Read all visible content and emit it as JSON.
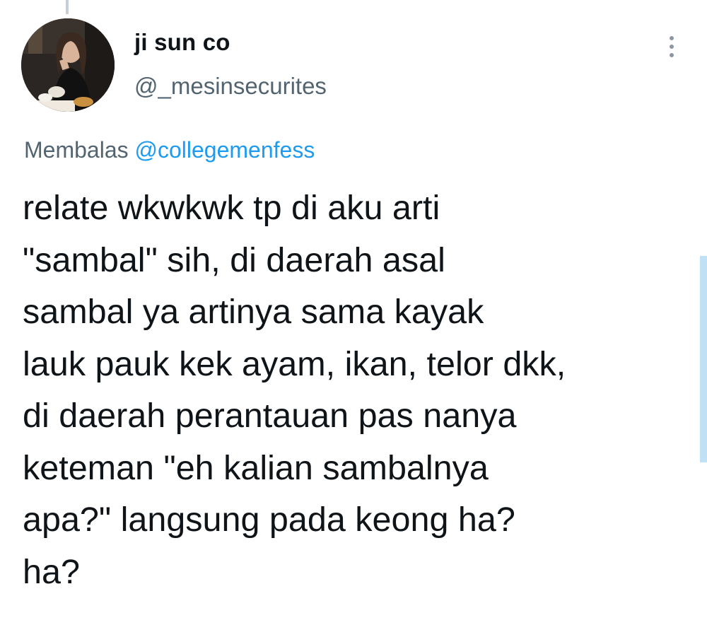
{
  "author": {
    "display_name": "ji sun co",
    "handle": "@_mesinsecurites"
  },
  "reply": {
    "prefix": "Membalas",
    "mention": "@collegemenfess"
  },
  "tweet": {
    "text": "relate wkwkwk tp di aku arti\n\"sambal\" sih, di daerah asal\nsambal ya artinya sama kayak\nlauk pauk kek ayam, ikan, telor dkk,\ndi daerah perantauan pas nanya\nketeman \"eh kalian sambalnya\napa?\" langsung pada keong ha?\nha?"
  },
  "icons": {
    "more": "more-vertical-icon"
  },
  "colors": {
    "text_primary": "#0f1419",
    "text_secondary": "#536471",
    "link": "#1d9bf0"
  }
}
